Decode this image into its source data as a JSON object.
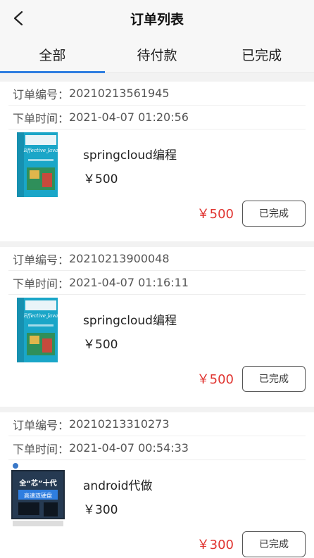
{
  "header": {
    "title": "订单列表"
  },
  "tabs": [
    {
      "label": "全部",
      "active": true
    },
    {
      "label": "待付款",
      "active": false
    },
    {
      "label": "已完成",
      "active": false
    }
  ],
  "order_no_label": "订单编号：",
  "order_time_label": "下单时间：",
  "orders": [
    {
      "order_no": "20210213561945",
      "order_time": "2021-04-07 01:20:56",
      "goods_name": "springcloud编程",
      "goods_price": "￥500",
      "total": "￥500",
      "status": "已完成",
      "cover": {
        "type": "book",
        "title": "Effective Java",
        "color": "#1aa6c8"
      }
    },
    {
      "order_no": "20210213900048",
      "order_time": "2021-04-07 01:16:11",
      "goods_name": "springcloud编程",
      "goods_price": "￥500",
      "total": "￥500",
      "status": "已完成",
      "cover": {
        "type": "book",
        "title": "Effective Java",
        "color": "#1aa6c8"
      }
    },
    {
      "order_no": "20210213310273",
      "order_time": "2021-04-07 00:54:33",
      "goods_name": "android代做",
      "goods_price": "￥300",
      "total": "￥300",
      "status": "已完成",
      "cover": {
        "type": "computer",
        "line1": "全“芯”十代",
        "line2": "高速双硬盘",
        "color": "#1e2b3a"
      }
    }
  ]
}
